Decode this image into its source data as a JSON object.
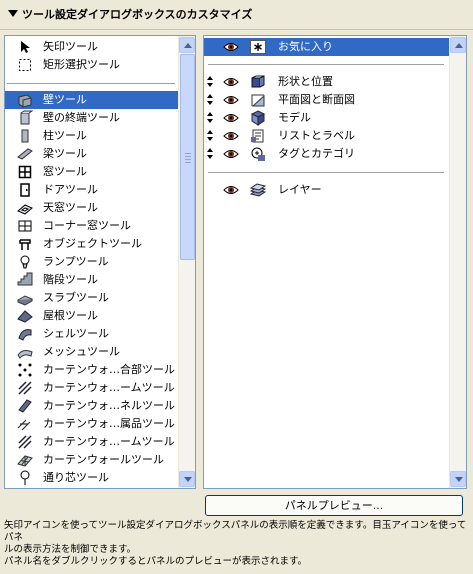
{
  "window": {
    "title": "ツール設定ダイアログボックスのカスタマイズ"
  },
  "tool_list": {
    "top_items": [
      {
        "label": "矢印ツール",
        "icon": "arrow-tool-icon"
      },
      {
        "label": "矩形選択ツール",
        "icon": "marquee-tool-icon"
      }
    ],
    "items": [
      {
        "label": "壁ツール",
        "icon": "wall-tool-icon",
        "selected": true
      },
      {
        "label": "壁の終端ツール",
        "icon": "wall-end-tool-icon"
      },
      {
        "label": "柱ツール",
        "icon": "column-tool-icon"
      },
      {
        "label": "梁ツール",
        "icon": "beam-tool-icon"
      },
      {
        "label": "窓ツール",
        "icon": "window-tool-icon"
      },
      {
        "label": "ドアツール",
        "icon": "door-tool-icon"
      },
      {
        "label": "天窓ツール",
        "icon": "skylight-tool-icon"
      },
      {
        "label": "コーナー窓ツール",
        "icon": "corner-window-tool-icon"
      },
      {
        "label": "オブジェクトツール",
        "icon": "object-tool-icon"
      },
      {
        "label": "ランプツール",
        "icon": "lamp-tool-icon"
      },
      {
        "label": "階段ツール",
        "icon": "stair-tool-icon"
      },
      {
        "label": "スラブツール",
        "icon": "slab-tool-icon"
      },
      {
        "label": "屋根ツール",
        "icon": "roof-tool-icon"
      },
      {
        "label": "シェルツール",
        "icon": "shell-tool-icon"
      },
      {
        "label": "メッシュツール",
        "icon": "mesh-tool-icon"
      },
      {
        "label": "カーテンウォ…合部ツール",
        "icon": "curtain-wall-junction-tool-icon"
      },
      {
        "label": "カーテンウォ…ームツール",
        "icon": "curtain-wall-frame-tool-icon"
      },
      {
        "label": "カーテンウォ…ネルツール",
        "icon": "curtain-wall-panel-tool-icon"
      },
      {
        "label": "カーテンウォ…属品ツール",
        "icon": "curtain-wall-accessory-tool-icon"
      },
      {
        "label": "カーテンウォ…ームツール",
        "icon": "curtain-wall-frame-tool-icon"
      },
      {
        "label": "カーテンウォールツール",
        "icon": "curtain-wall-tool-icon"
      },
      {
        "label": "通り芯ツール",
        "icon": "grid-tool-icon"
      }
    ]
  },
  "panel_list": {
    "favorites": {
      "label": "お気に入り",
      "selected": true
    },
    "panels": [
      {
        "label": "形状と位置",
        "icon": "geometry-icon"
      },
      {
        "label": "平面図と断面図",
        "icon": "floor-plan-section-icon"
      },
      {
        "label": "モデル",
        "icon": "model-icon"
      },
      {
        "label": "リストとラベル",
        "icon": "list-label-icon"
      },
      {
        "label": "タグとカテゴリ",
        "icon": "tag-category-icon"
      }
    ],
    "layer": {
      "label": "レイヤー",
      "icon": "layer-icon"
    }
  },
  "preview_button": {
    "label": "パネルプレビュー..."
  },
  "help": {
    "line1": "矢印アイコンを使ってツール設定ダイアログボックスパネルの表示順を定義できます。目玉アイコンを使ってパネ",
    "line2": "ルの表示方法を制御できます。",
    "line3": "パネル名をダブルクリックするとパネルのプレビューが表示されます。"
  },
  "colors": {
    "selection": "#316ac5",
    "dialog_bg": "#ece9d8",
    "list_border": "#7f9db9"
  }
}
